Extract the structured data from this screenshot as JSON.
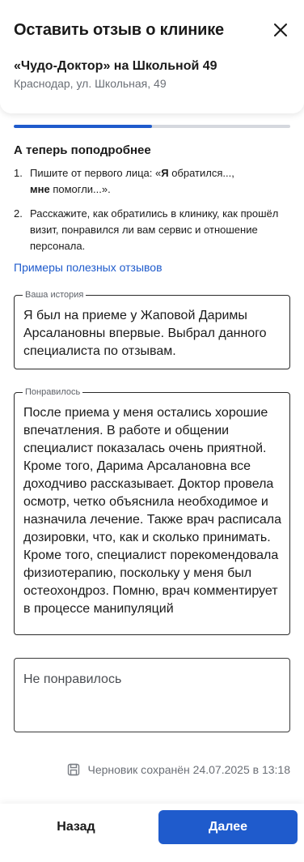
{
  "header": {
    "title": "Оставить отзыв о клинике",
    "clinic_name": "«Чудо-Доктор» на Школьной 49",
    "clinic_address": "Краснодар, ул. Школьная, 49",
    "close_icon": "close-icon"
  },
  "progress": {
    "value": 0.5
  },
  "guide": {
    "title": "А теперь поподробнее",
    "tips": [
      {
        "number": "1.",
        "parts": [
          "Пишите от первого лица: «",
          "Я",
          " обратился...,",
          "мне",
          " помогли...»."
        ]
      },
      {
        "number": "2.",
        "text": "Расскажите, как обратились в клинику, как прошёл визит, понравился ли вам сервис и отношение персонала."
      }
    ],
    "examples_link": "Примеры полезных отзывов"
  },
  "fields": {
    "story": {
      "label": "Ваша история",
      "value": "Я был на приеме у Жаповой Даримы Арсалановны впервые. Выбрал данного специалиста по отзывам."
    },
    "liked": {
      "label": "Понравилось",
      "value": "После приема у меня остались хорошие впечатления. В работе и общении специалист показалась очень приятной. Кроме того, Дарима Арсалановна все доходчиво рассказывает. Доктор провела осмотр, четко объяснила необходимое и назначила лечение. Также врач расписала дозировки, что, как и сколько принимать. Кроме того, специалист порекомендовала физиотерапию, поскольку у меня был остеохондроз. Помню, врач комментирует в процессе манипуляций"
    },
    "disliked": {
      "placeholder": "Не понравилось",
      "value": ""
    }
  },
  "draft": {
    "text": "Черновик сохранён 24.07.2025 в 13:18",
    "icon": "save-icon"
  },
  "footer": {
    "back_label": "Назад",
    "next_label": "Далее"
  },
  "colors": {
    "accent": "#1f5bcc",
    "progress_track": "#d5d8de",
    "muted_text": "#6b6f76"
  }
}
